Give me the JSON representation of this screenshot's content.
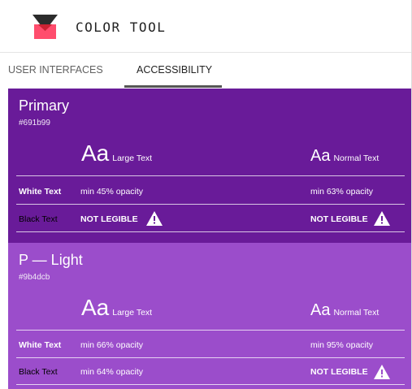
{
  "app": {
    "title": "COLOR TOOL"
  },
  "tabs": [
    {
      "label": "USER INTERFACES",
      "active": false
    },
    {
      "label": "ACCESSIBILITY",
      "active": true
    }
  ],
  "panels": [
    {
      "name": "Primary",
      "hex": "#691b99",
      "background": "#691b99",
      "large_sample": "Aa",
      "large_label": "Large Text",
      "normal_sample": "Aa",
      "normal_label": "Normal Text",
      "white_row": {
        "label": "White Text",
        "large": "min 45% opacity",
        "normal": "min 63% opacity"
      },
      "black_row": {
        "label": "Black Text",
        "large": "NOT LEGIBLE",
        "normal": "NOT LEGIBLE"
      }
    },
    {
      "name": "P — Light",
      "hex": "#9b4dcb",
      "background": "#9b4dcb",
      "large_sample": "Aa",
      "large_label": "Large Text",
      "normal_sample": "Aa",
      "normal_label": "Normal Text",
      "white_row": {
        "label": "White Text",
        "large": "min 66% opacity",
        "normal": "min 95% opacity"
      },
      "black_row": {
        "label": "Black Text",
        "large": "min 64% opacity",
        "normal": "NOT LEGIBLE"
      }
    }
  ],
  "colors": {
    "logo_top": "#2c2c2c",
    "logo_bottom": "#ff4d6d",
    "logo_overlap": "#cc2233"
  },
  "icons": {
    "warning": "warning-icon",
    "logo": "color-tool-logo"
  }
}
